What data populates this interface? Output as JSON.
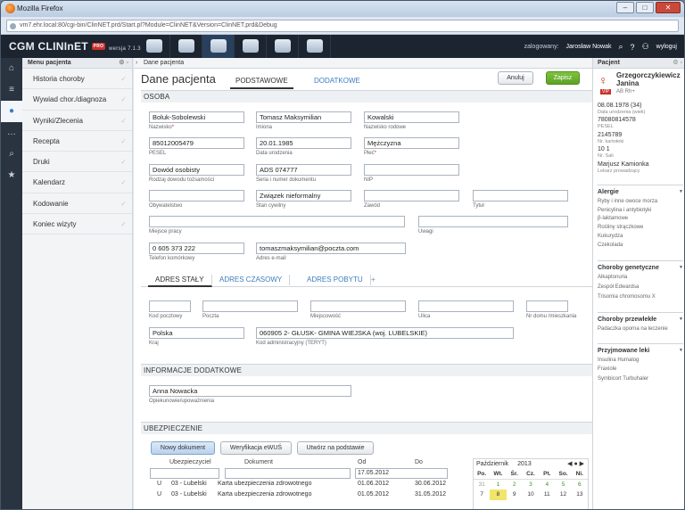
{
  "browser": {
    "title": "Mozilla Firefox",
    "url": "vm7.ehr.local:80/cgi-bin/ClinNET.prd/Start.pl?Module=ClinNET&Version=ClinNET.prd&Debug"
  },
  "app": {
    "brand": "CGM CLINInET",
    "pro_badge": "PRO",
    "version": "wersja 7.1.3",
    "user_label": "zalogowany:",
    "user_name": "Jarosław Nowak",
    "logout": "wyloguj"
  },
  "menu": {
    "title": "Menu pacjenta",
    "items": [
      {
        "label": "Historia choroby"
      },
      {
        "label": "Wywiad chor./diagnoza"
      },
      {
        "label": "Wyniki/Zlecenia"
      },
      {
        "label": "Recepta"
      },
      {
        "label": "Druki"
      },
      {
        "label": "Kalendarz"
      },
      {
        "label": "Kodowanie"
      },
      {
        "label": "Koniec wizyty"
      }
    ]
  },
  "breadcrumb": "Dane pacjenta",
  "page": {
    "title": "Dane pacjenta",
    "tabs": [
      "PODSTAWOWE",
      "DODATKOWE"
    ],
    "cancel": "Anuluj",
    "save": "Zapisz"
  },
  "osoba": {
    "section": "OSOBA",
    "fields": {
      "nazwisko": {
        "value": "Boluk-Sobolewski",
        "label": "Nazwisko"
      },
      "imiona": {
        "value": "Tomasz Maksymilian",
        "label": "Imiona"
      },
      "nazwisko_rodowe": {
        "value": "Kowalski",
        "label": "Nazwisko rodowe"
      },
      "pesel": {
        "value": "85012005479",
        "label": "PESEL"
      },
      "data_urodzenia": {
        "value": "20.01.1985",
        "label": "Data urodzenia"
      },
      "plec": {
        "value": "Mężczyzna",
        "label": "Płeć"
      },
      "rodzaj_dowodu": {
        "value": "Dowód osobisty",
        "label": "Rodzaj dowodu tożsamości"
      },
      "seria_numer": {
        "value": "ADS 074777",
        "label": "Seria i numer dokumentu"
      },
      "nip": {
        "value": "",
        "label": "NIP"
      },
      "obywatelstwo": {
        "value": "",
        "label": "Obywatelstwo"
      },
      "stan_cywilny": {
        "value": "Związek nieformalny",
        "label": "Stan cywilny"
      },
      "zawod": {
        "value": "",
        "label": "Zawód"
      },
      "tytul": {
        "value": "",
        "label": "Tytuł"
      },
      "miejsce_pracy": {
        "value": "",
        "label": "Miejsce pracy"
      },
      "uwagi": {
        "value": "",
        "label": "Uwagi"
      },
      "telefon": {
        "value": "0 605 373 222",
        "label": "Telefon komórkowy"
      },
      "email": {
        "value": "tomaszmaksymilian@poczta.com",
        "label": "Adres e-mail"
      }
    }
  },
  "adres": {
    "tabs": [
      "ADRES STAŁY",
      "ADRES CZASOWY",
      "ADRES POBYTU",
      "+"
    ],
    "labels": {
      "kod": "Kod pocztowy",
      "poczta": "Poczta",
      "miejscowosc": "Miejscowość",
      "ulica": "Ulica",
      "nr_domu": "Nr domu /mieszkania",
      "kraj": "Kraj",
      "kod_adm": "Kod administracyjny (TERYT)"
    },
    "kraj": "Polska",
    "kod_adm": "060905 2- GŁUSK- GMINA WIEJSKA (woj. LUBELSKIE)"
  },
  "info": {
    "section": "INFORMACJE DODATKOWE",
    "opiekun_value": "Anna Nowacka",
    "opiekun_label": "Opiekunowie/upoważnienia"
  },
  "ubezpieczenie": {
    "section": "UBEZPIECZENIE",
    "buttons": [
      "Nowy dokument",
      "Weryfikacja eWUŚ",
      "Utwórz na podstawie"
    ],
    "columns": [
      "Ubezpieczyciel",
      "Dokument",
      "Od",
      "Do"
    ],
    "filter_od": "17.05.2012",
    "rows": [
      {
        "typ": "U",
        "ubezpieczyciel": "03 - Lubelski",
        "dokument": "Karta ubezpieczenia zdrowotnego",
        "od": "01.06.2012",
        "do": "30.06.2012"
      },
      {
        "typ": "U",
        "ubezpieczyciel": "03 - Lubelski",
        "dokument": "Karta ubezpieczenia zdrowotnego",
        "od": "01.05.2012",
        "do": "31.05.2012"
      }
    ]
  },
  "calendar": {
    "month": "Październik",
    "year": "2013",
    "days": [
      "Po.",
      "Wt.",
      "Śr.",
      "Cz.",
      "Pt.",
      "So.",
      "Ni."
    ],
    "row1": [
      "31",
      "1",
      "2",
      "3",
      "4",
      "5",
      "6"
    ],
    "row2": [
      "7",
      "8",
      "9",
      "10",
      "11",
      "12",
      "13"
    ]
  },
  "patient": {
    "title": "Pacjent",
    "name": "Grzegorczykiewicz Janina",
    "vip": "VIP",
    "blood": "AB Rh+",
    "birth": "08.08.1978 (34)",
    "birth_label": "Data urodzenia (wiek)",
    "pesel": "78080814578",
    "pesel_label": "PESEL",
    "kartoteka": "2145789",
    "kartoteka_label": "Nr. kartoteki",
    "sala": "10 1",
    "sala_label": "Nr. Sali",
    "lekarz": "Marjusz Kamionka",
    "lekarz_label": "Lekarz prowadzący",
    "sections": [
      {
        "title": "Alergie",
        "items": [
          "Ryby i inne owoce morza",
          "Penicylina i antybiotyki",
          "β-laktamowe",
          "Rośliny strączkowe",
          "Kukurydza",
          "Czekolada"
        ]
      },
      {
        "title": "Choroby genetyczne",
        "items": [
          "Alkaptonuria",
          "Zespół Edwardsa",
          "Trisomia chromosomu X"
        ]
      },
      {
        "title": "Choroby przewlekłe",
        "items": [
          "Padaczka oporna na leczenie"
        ]
      },
      {
        "title": "Przyjmowane leki",
        "items": [
          "Insulina Humalog",
          "Fraxiole",
          "Symbicort Turbuhaler"
        ]
      }
    ]
  }
}
